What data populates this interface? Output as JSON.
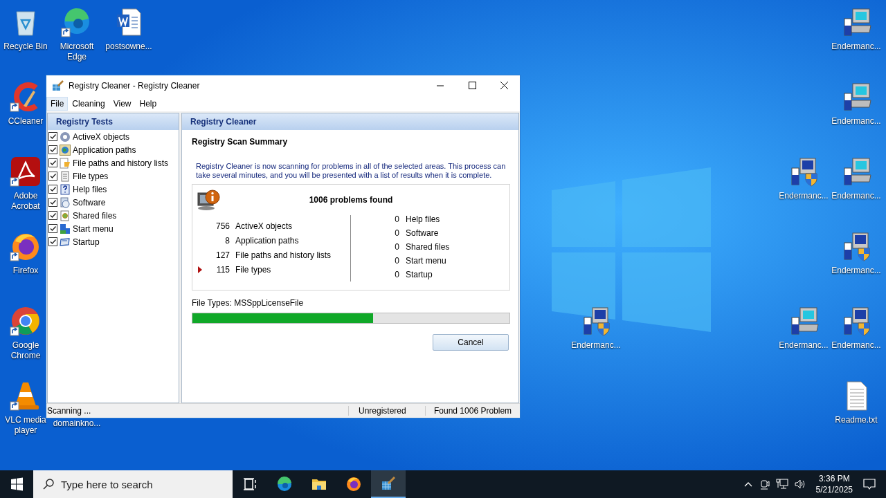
{
  "desktop_icons": [
    {
      "label": "Recycle Bin",
      "kind": "recycle-bin",
      "shortcut": false
    },
    {
      "label": "Microsoft Edge",
      "kind": "edge",
      "shortcut": true
    },
    {
      "label": "postsowne...",
      "kind": "word-document",
      "shortcut": false
    },
    {
      "label": "CCleaner",
      "kind": "ccleaner",
      "shortcut": true
    },
    {
      "label": "Adobe Acrobat",
      "kind": "acrobat",
      "shortcut": true
    },
    {
      "label": "Firefox",
      "kind": "firefox",
      "shortcut": true
    },
    {
      "label": "Google Chrome",
      "kind": "chrome",
      "shortcut": true
    },
    {
      "label": "VLC media player",
      "kind": "vlc",
      "shortcut": true
    },
    {
      "label": "domainkno...",
      "kind": "covered",
      "shortcut": false
    },
    {
      "label": "Endermanc...",
      "kind": "installer",
      "shortcut": false
    },
    {
      "label": "Endermanc...",
      "kind": "installer",
      "shortcut": false
    },
    {
      "label": "Endermanc...",
      "kind": "installer-shield",
      "shortcut": false
    },
    {
      "label": "Endermanc...",
      "kind": "installer",
      "shortcut": false
    },
    {
      "label": "Endermanc...",
      "kind": "installer-shield",
      "shortcut": false
    },
    {
      "label": "Endermanc...",
      "kind": "installer-shield",
      "shortcut": false
    },
    {
      "label": "Endermanc...",
      "kind": "installer",
      "shortcut": false
    },
    {
      "label": "Endermanc...",
      "kind": "installer-shield",
      "shortcut": false
    },
    {
      "label": "Readme.txt",
      "kind": "text-file",
      "shortcut": false
    }
  ],
  "window": {
    "title": "Registry Cleaner - Registry Cleaner",
    "menu": [
      {
        "label": "File",
        "selected": true
      },
      {
        "label": "Cleaning",
        "selected": false
      },
      {
        "label": "View",
        "selected": false
      },
      {
        "label": "Help",
        "selected": false
      }
    ],
    "sidebar": {
      "title": "Registry Tests",
      "items": [
        {
          "label": "ActiveX objects",
          "checked": true,
          "kind": "gear"
        },
        {
          "label": "Application paths",
          "checked": true,
          "kind": "globe"
        },
        {
          "label": "File paths and history lists",
          "checked": true,
          "kind": "folder"
        },
        {
          "label": "File types",
          "checked": true,
          "kind": "document"
        },
        {
          "label": "Help files",
          "checked": true,
          "kind": "help"
        },
        {
          "label": "Software",
          "checked": true,
          "kind": "software"
        },
        {
          "label": "Shared files",
          "checked": true,
          "kind": "shared"
        },
        {
          "label": "Start menu",
          "checked": true,
          "kind": "start"
        },
        {
          "label": "Startup",
          "checked": true,
          "kind": "startup"
        }
      ]
    },
    "panel": {
      "title": "Registry Cleaner",
      "heading": "Registry Scan Summary",
      "description": "Registry Cleaner is now scanning for problems in all of the selected areas. This process can take several minutes, and you will be presented with a list of results when it is complete.",
      "summary_title": "1006 problems found",
      "left_results": [
        {
          "count": "756",
          "label": "ActiveX objects",
          "current": false
        },
        {
          "count": "8",
          "label": "Application paths",
          "current": false
        },
        {
          "count": "127",
          "label": "File paths and history lists",
          "current": false
        },
        {
          "count": "115",
          "label": "File types",
          "current": true
        }
      ],
      "right_results": [
        {
          "count": "0",
          "label": "Help files"
        },
        {
          "count": "0",
          "label": "Software"
        },
        {
          "count": "0",
          "label": "Shared files"
        },
        {
          "count": "0",
          "label": "Start menu"
        },
        {
          "count": "0",
          "label": "Startup"
        }
      ],
      "current_item": "File Types: MSSppLicenseFile",
      "progress": {
        "level": 0.57
      },
      "button": "Cancel"
    },
    "status_bar": [
      "Scanning ...",
      "Unregistered",
      "Found 1006 Problem"
    ]
  },
  "taskbar": {
    "search": {
      "placeholder": "Type here to search"
    },
    "apps": [
      {
        "kind": "task-view",
        "selected": false
      },
      {
        "kind": "edge",
        "selected": false
      },
      {
        "kind": "explorer",
        "selected": false
      },
      {
        "kind": "firefox",
        "selected": false
      },
      {
        "kind": "registry-cleaner",
        "selected": true
      }
    ],
    "time": "3:36 PM",
    "date": "5/21/2025"
  }
}
